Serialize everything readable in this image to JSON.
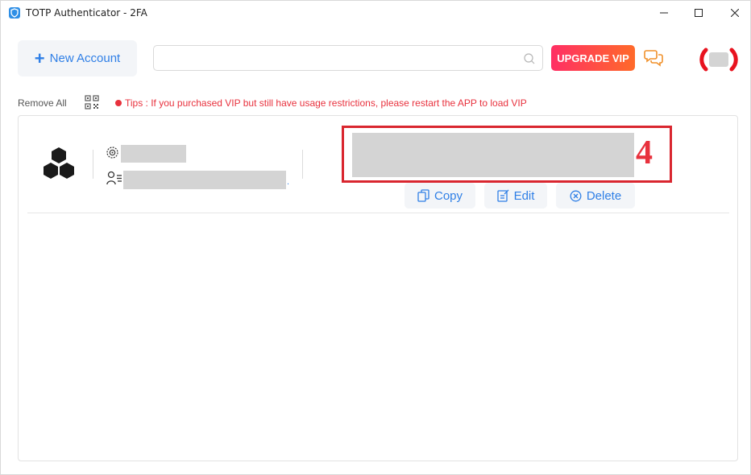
{
  "window": {
    "title": "TOTP Authenticator - 2FA",
    "minimize_glyph": "—",
    "maximize_glyph": "☐",
    "close_glyph": "✕"
  },
  "toolbar": {
    "new_account_label": "New Account",
    "search_value": "",
    "search_placeholder": "",
    "upgrade_label": "UPGRADE VIP"
  },
  "actions_row": {
    "remove_all_label": "Remove All",
    "tips_text": "Tips : If you purchased VIP but still have usage restrictions, please restart the APP to load VIP"
  },
  "accounts": [
    {
      "code_visible_digit": "4",
      "copy_label": "Copy",
      "edit_label": "Edit",
      "delete_label": "Delete",
      "account_trailing": "."
    }
  ],
  "colors": {
    "accent": "#2f7fe6",
    "tips": "#e8313d",
    "highlight_box": "#d9262f",
    "upgrade_gradient_start": "#ff2f64",
    "upgrade_gradient_end": "#ff6a2a",
    "chat_icon": "#f0902a"
  },
  "icons": {
    "app": "shield-icon",
    "search": "search-icon",
    "chat": "chat-bubbles-icon",
    "qr": "qr-code-icon",
    "issuer": "gear-icon",
    "account": "user-list-icon",
    "logo": "hexagon-cluster-icon",
    "copy": "copy-icon",
    "edit": "edit-icon",
    "delete": "close-circle-icon"
  }
}
